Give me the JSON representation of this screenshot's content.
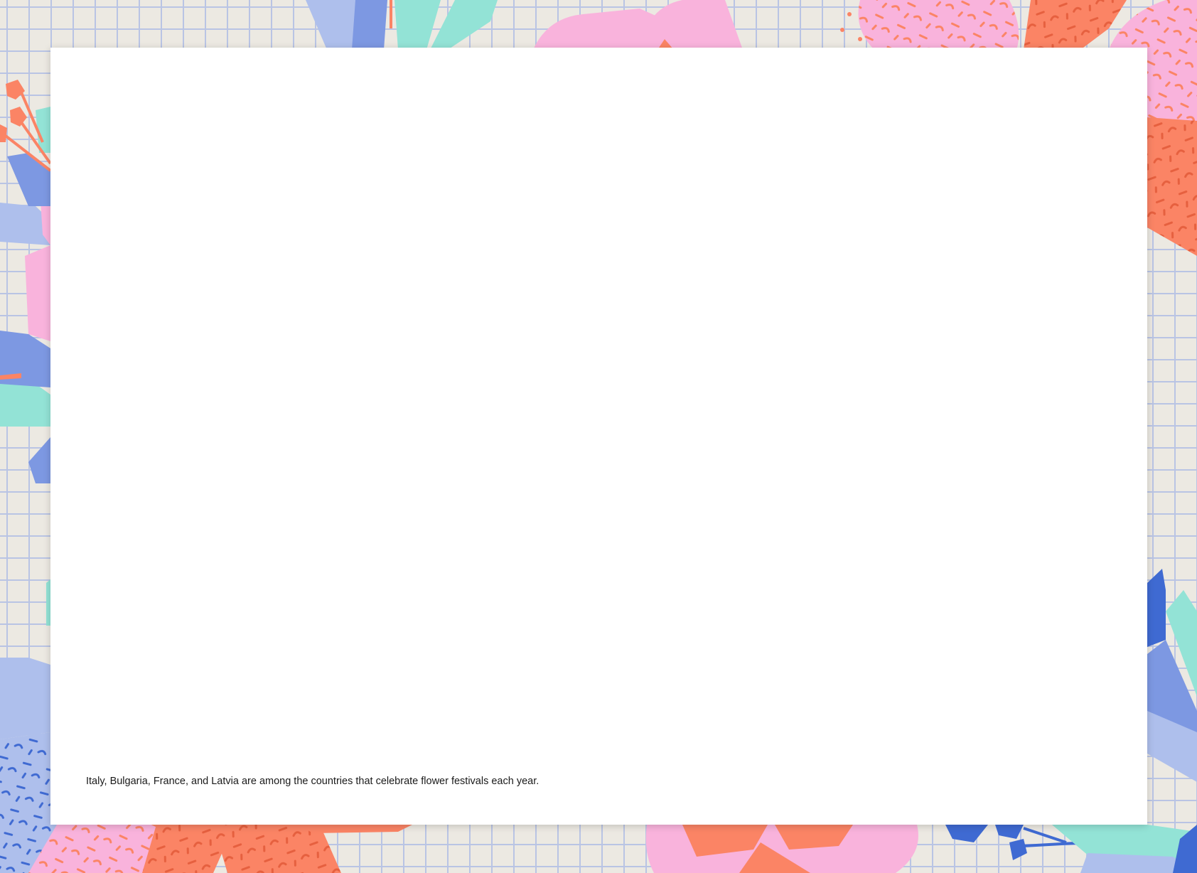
{
  "card": {
    "caption": "Italy, Bulgaria, France, and Latvia are among the countries that celebrate flower festivals each year."
  },
  "decor": {
    "colors": {
      "background": "#ece9e2",
      "grid": "#b9c4e4",
      "pink": "#f9b3dc",
      "coral": "#fb8465",
      "mint": "#93e3d6",
      "periwinkle": "#7d98e2",
      "light_blue": "#aebfec",
      "blue": "#3f6ad2"
    },
    "icons": [
      "flower-petal-icon",
      "leaf-icon",
      "stamen-icon",
      "confetti-pattern-icon"
    ]
  }
}
